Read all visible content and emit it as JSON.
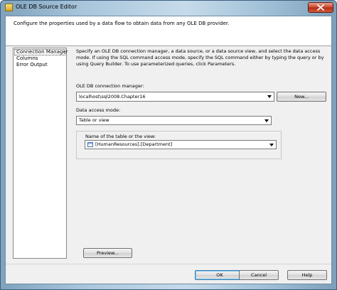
{
  "window": {
    "title": "OLE DB Source Editor",
    "close_icon": "close-icon"
  },
  "header": {
    "text": "Configure the properties used by a data flow to obtain data from any OLE DB provider."
  },
  "nav": {
    "items": [
      {
        "label": "Connection Manager",
        "selected": true
      },
      {
        "label": "Columns",
        "selected": false
      },
      {
        "label": "Error Output",
        "selected": false
      }
    ]
  },
  "main": {
    "description": "Specify an OLE DB connection manager, a data source, or a data source view, and select the data access mode. If using the SQL command access mode, specify the SQL command either by typing the query or by using Query Builder. To use parameterized queries, click Parameters.",
    "connection_label": "OLE DB connection manager:",
    "connection_value": "localhost\\sql2008.Chapter16",
    "new_button": "New...",
    "access_mode_label": "Data access mode:",
    "access_mode_value": "Table or view",
    "table_label": "Name of the table or the view:",
    "table_value": "[HumanResources].[Department]",
    "preview_button": "Preview..."
  },
  "footer": {
    "ok": "OK",
    "cancel": "Cancel",
    "help": "Help"
  },
  "colors": {
    "selection_outline": "#444444",
    "title_gradient_mid": "#c6dbea"
  }
}
